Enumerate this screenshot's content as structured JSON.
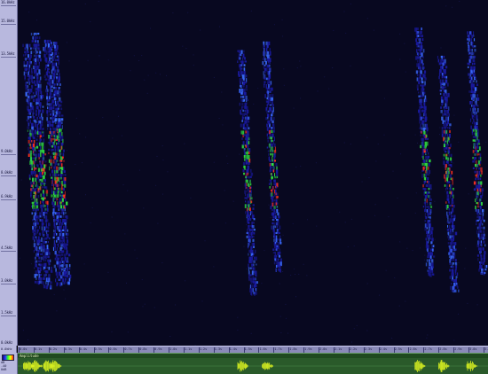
{
  "freq_axis": {
    "ticks": [
      {
        "label": "16.0kHz",
        "value": 16.0
      },
      {
        "label": "15.0kHz",
        "value": 15.0
      },
      {
        "label": "13.5kHz",
        "value": 13.5
      },
      {
        "label": "9.0kHz",
        "value": 9.0
      },
      {
        "label": "8.0kHz",
        "value": 8.0
      },
      {
        "label": "6.9kHz",
        "value": 6.9
      },
      {
        "label": "4.5kHz",
        "value": 4.5
      },
      {
        "label": "3.0kHz",
        "value": 3.0
      },
      {
        "label": "1.5kHz",
        "value": 1.5
      },
      {
        "label": "0.0kHz",
        "value": 0.0
      }
    ]
  },
  "time_ruler": {
    "ticks": [
      "0.0s",
      "0.1s",
      "0.2s",
      "0.3s",
      "0.4s",
      "0.5s",
      "0.6s",
      "0.7s",
      "0.8s",
      "0.9s",
      "1.0s",
      "1.1s",
      "1.2s",
      "1.3s",
      "1.4s",
      "1.5s",
      "1.6s",
      "1.7s",
      "1.8s",
      "1.9s",
      "2.0s",
      "2.1s",
      "2.2s",
      "2.3s",
      "2.4s",
      "2.5s",
      "2.6s",
      "2.7s",
      "2.8s",
      "2.9s",
      "3.0s",
      "3.1s"
    ],
    "corner": "0.0kHz"
  },
  "amplitude": {
    "label": "Amplitude"
  },
  "left_panel": {
    "line1": "dB",
    "line2": "-40",
    "line3": "0dB"
  },
  "calls": {
    "groups": [
      {
        "strokes": [
          0.012,
          0.03,
          0.055,
          0.07
        ]
      },
      {
        "strokes": [
          0.468,
          0.52
        ]
      },
      {
        "strokes": [
          0.845,
          0.895,
          0.955
        ]
      }
    ]
  },
  "colors": {
    "background": "#080820",
    "low": "#1a1aa0",
    "mid": "#3a6aff",
    "high": "#30e040",
    "peak": "#ff3020",
    "amp_wave": "#d8f020",
    "amp_bg": "#2a5a2a"
  }
}
